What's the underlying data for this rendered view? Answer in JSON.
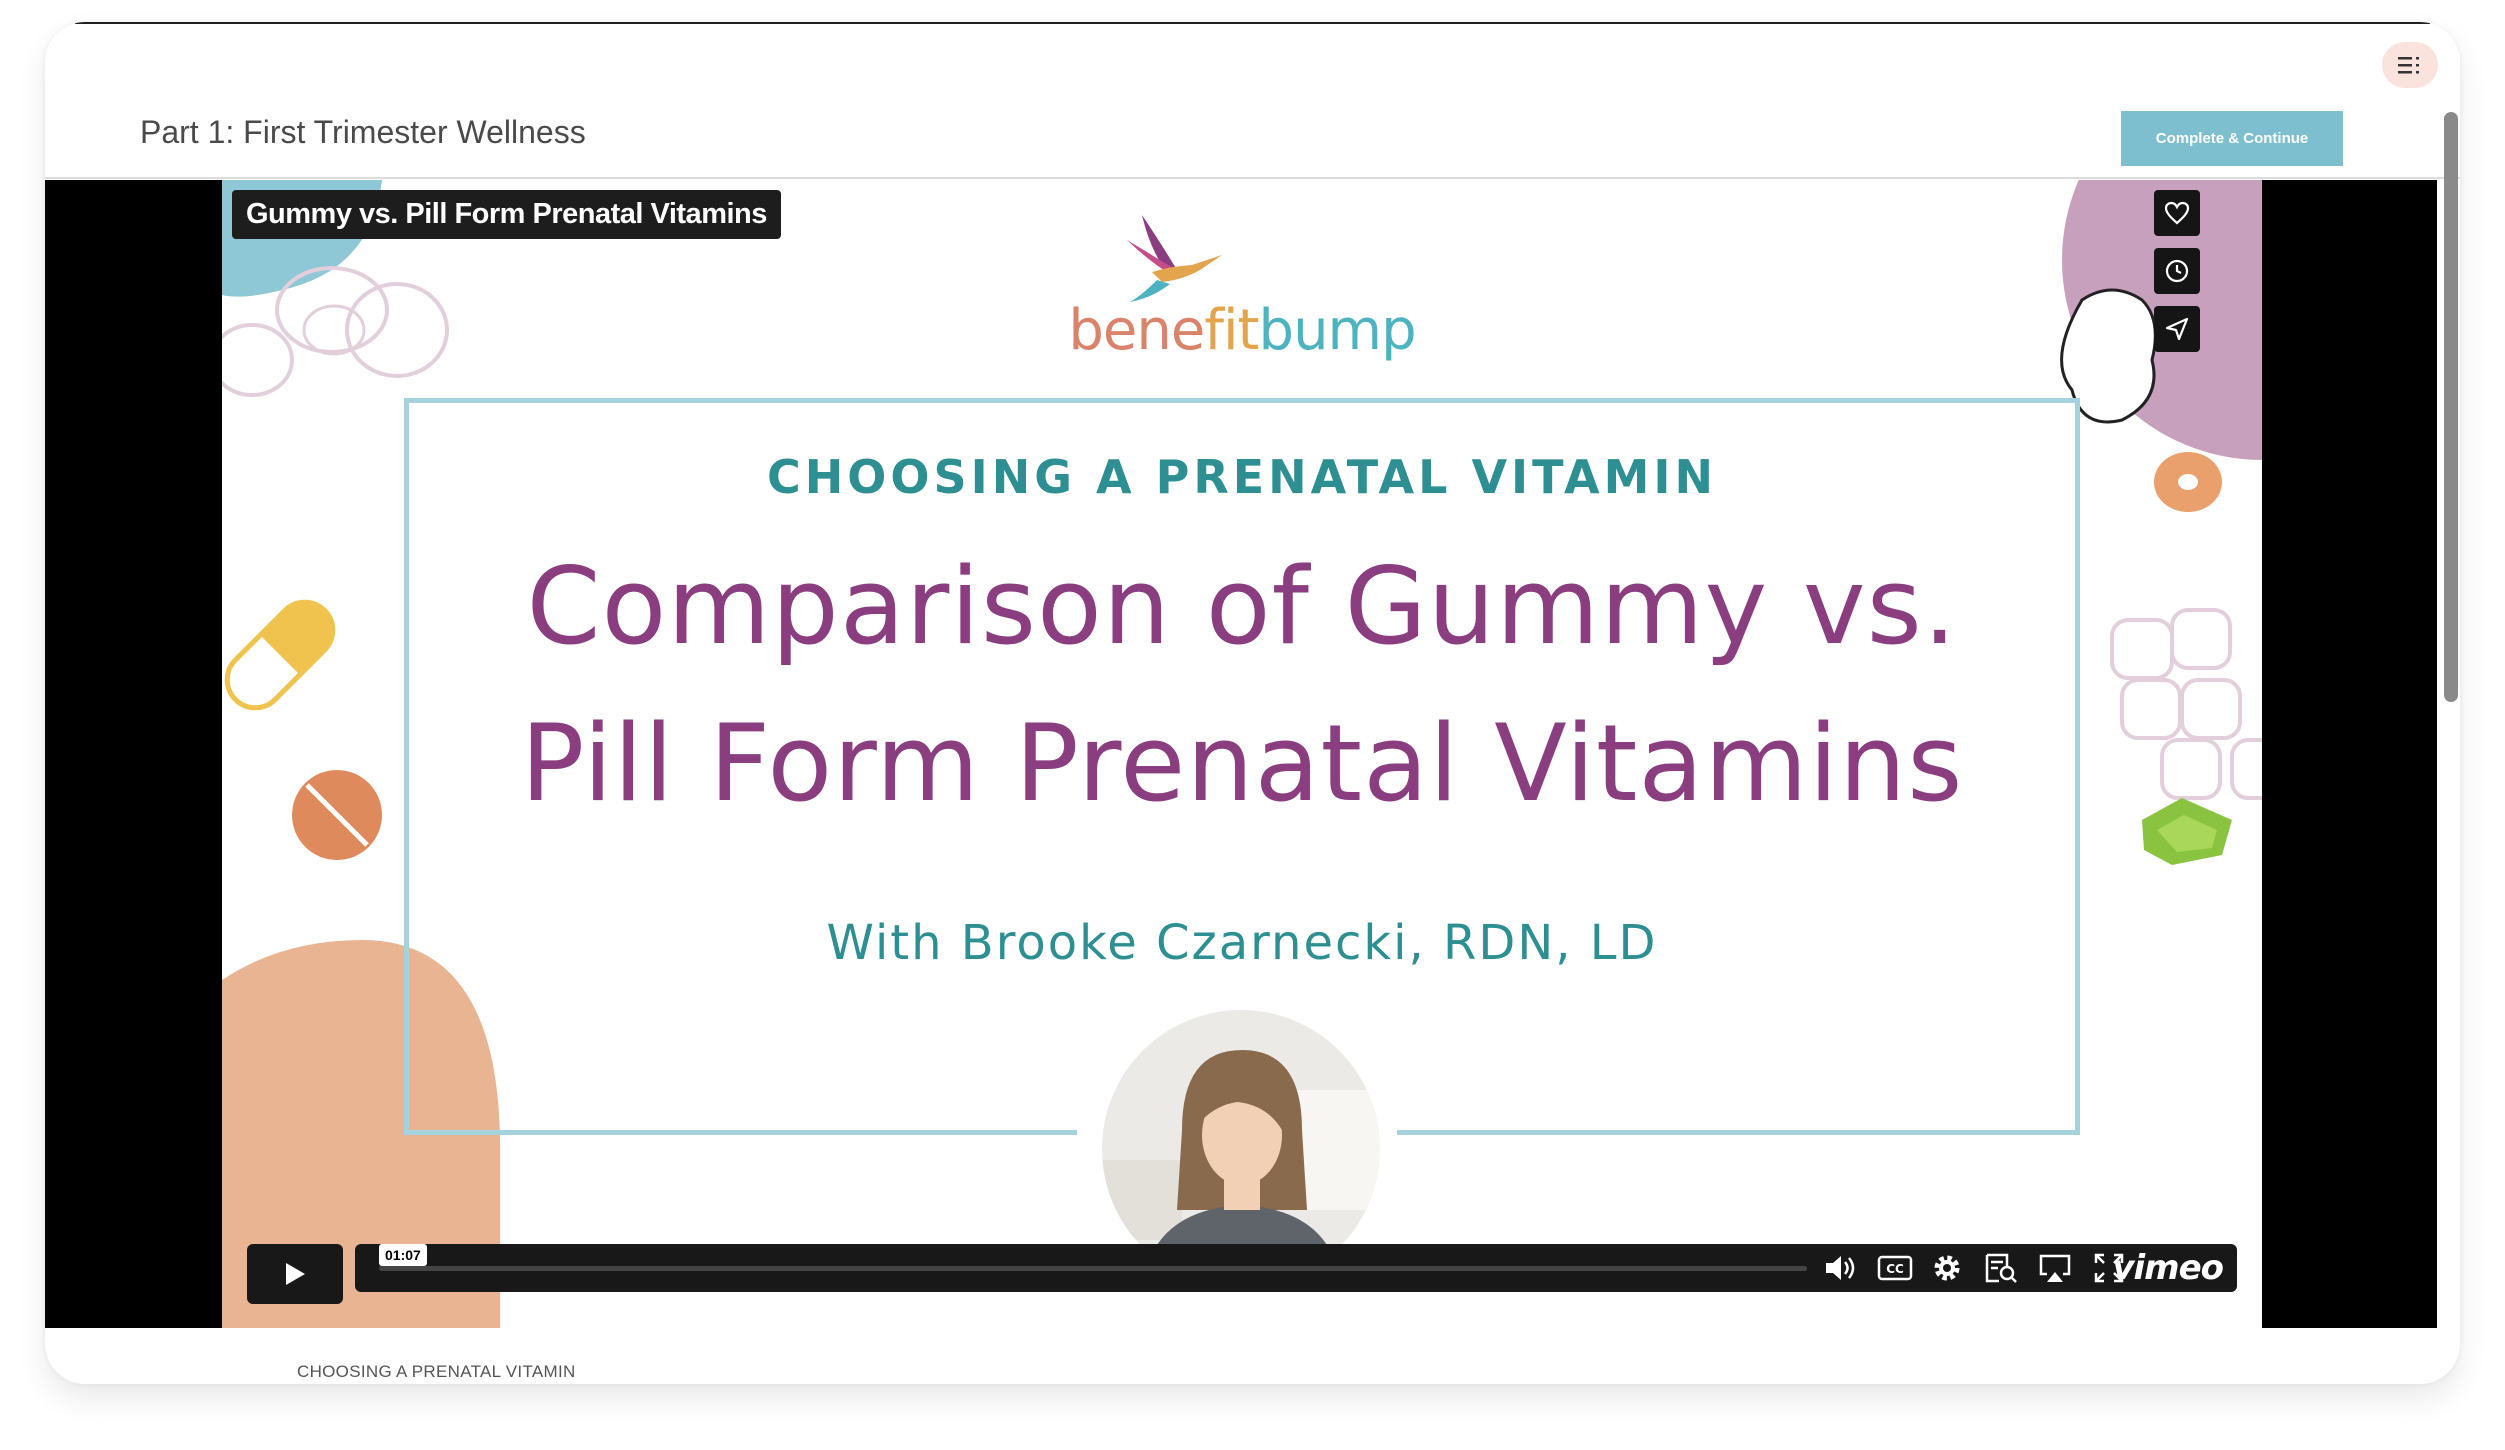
{
  "header": {
    "part_title": "Part 1: First Trimester Wellness",
    "complete_label": "Complete & Continue",
    "menu_icon": "list-menu-icon"
  },
  "video": {
    "overlay_title": "Gummy vs. Pill Form Prenatal Vitamins",
    "side_buttons": [
      "heart-icon",
      "clock-icon",
      "send-icon"
    ],
    "time_label": "01:07",
    "progress_fraction": 0.0,
    "brand": "vimeo",
    "controls": [
      "volume-icon",
      "cc-icon",
      "settings-icon",
      "transcript-icon",
      "airplay-icon",
      "fullscreen-icon"
    ]
  },
  "slide": {
    "logo": {
      "part1": "bene",
      "part2": "fit",
      "part3": "bump"
    },
    "kicker": "CHOOSING A PRENATAL VITAMIN",
    "title_line1": "Comparison of Gummy vs.",
    "title_line2": "Pill Form Prenatal Vitamins",
    "byline": "With Brooke Czarnecki, RDN, LD"
  },
  "below": {
    "caption": "CHOOSING A PRENATAL VITAMIN"
  },
  "colors": {
    "accent_teal": "#2d8f91",
    "title_purple": "#8a3e80",
    "button_blue": "#7ebfcf"
  }
}
